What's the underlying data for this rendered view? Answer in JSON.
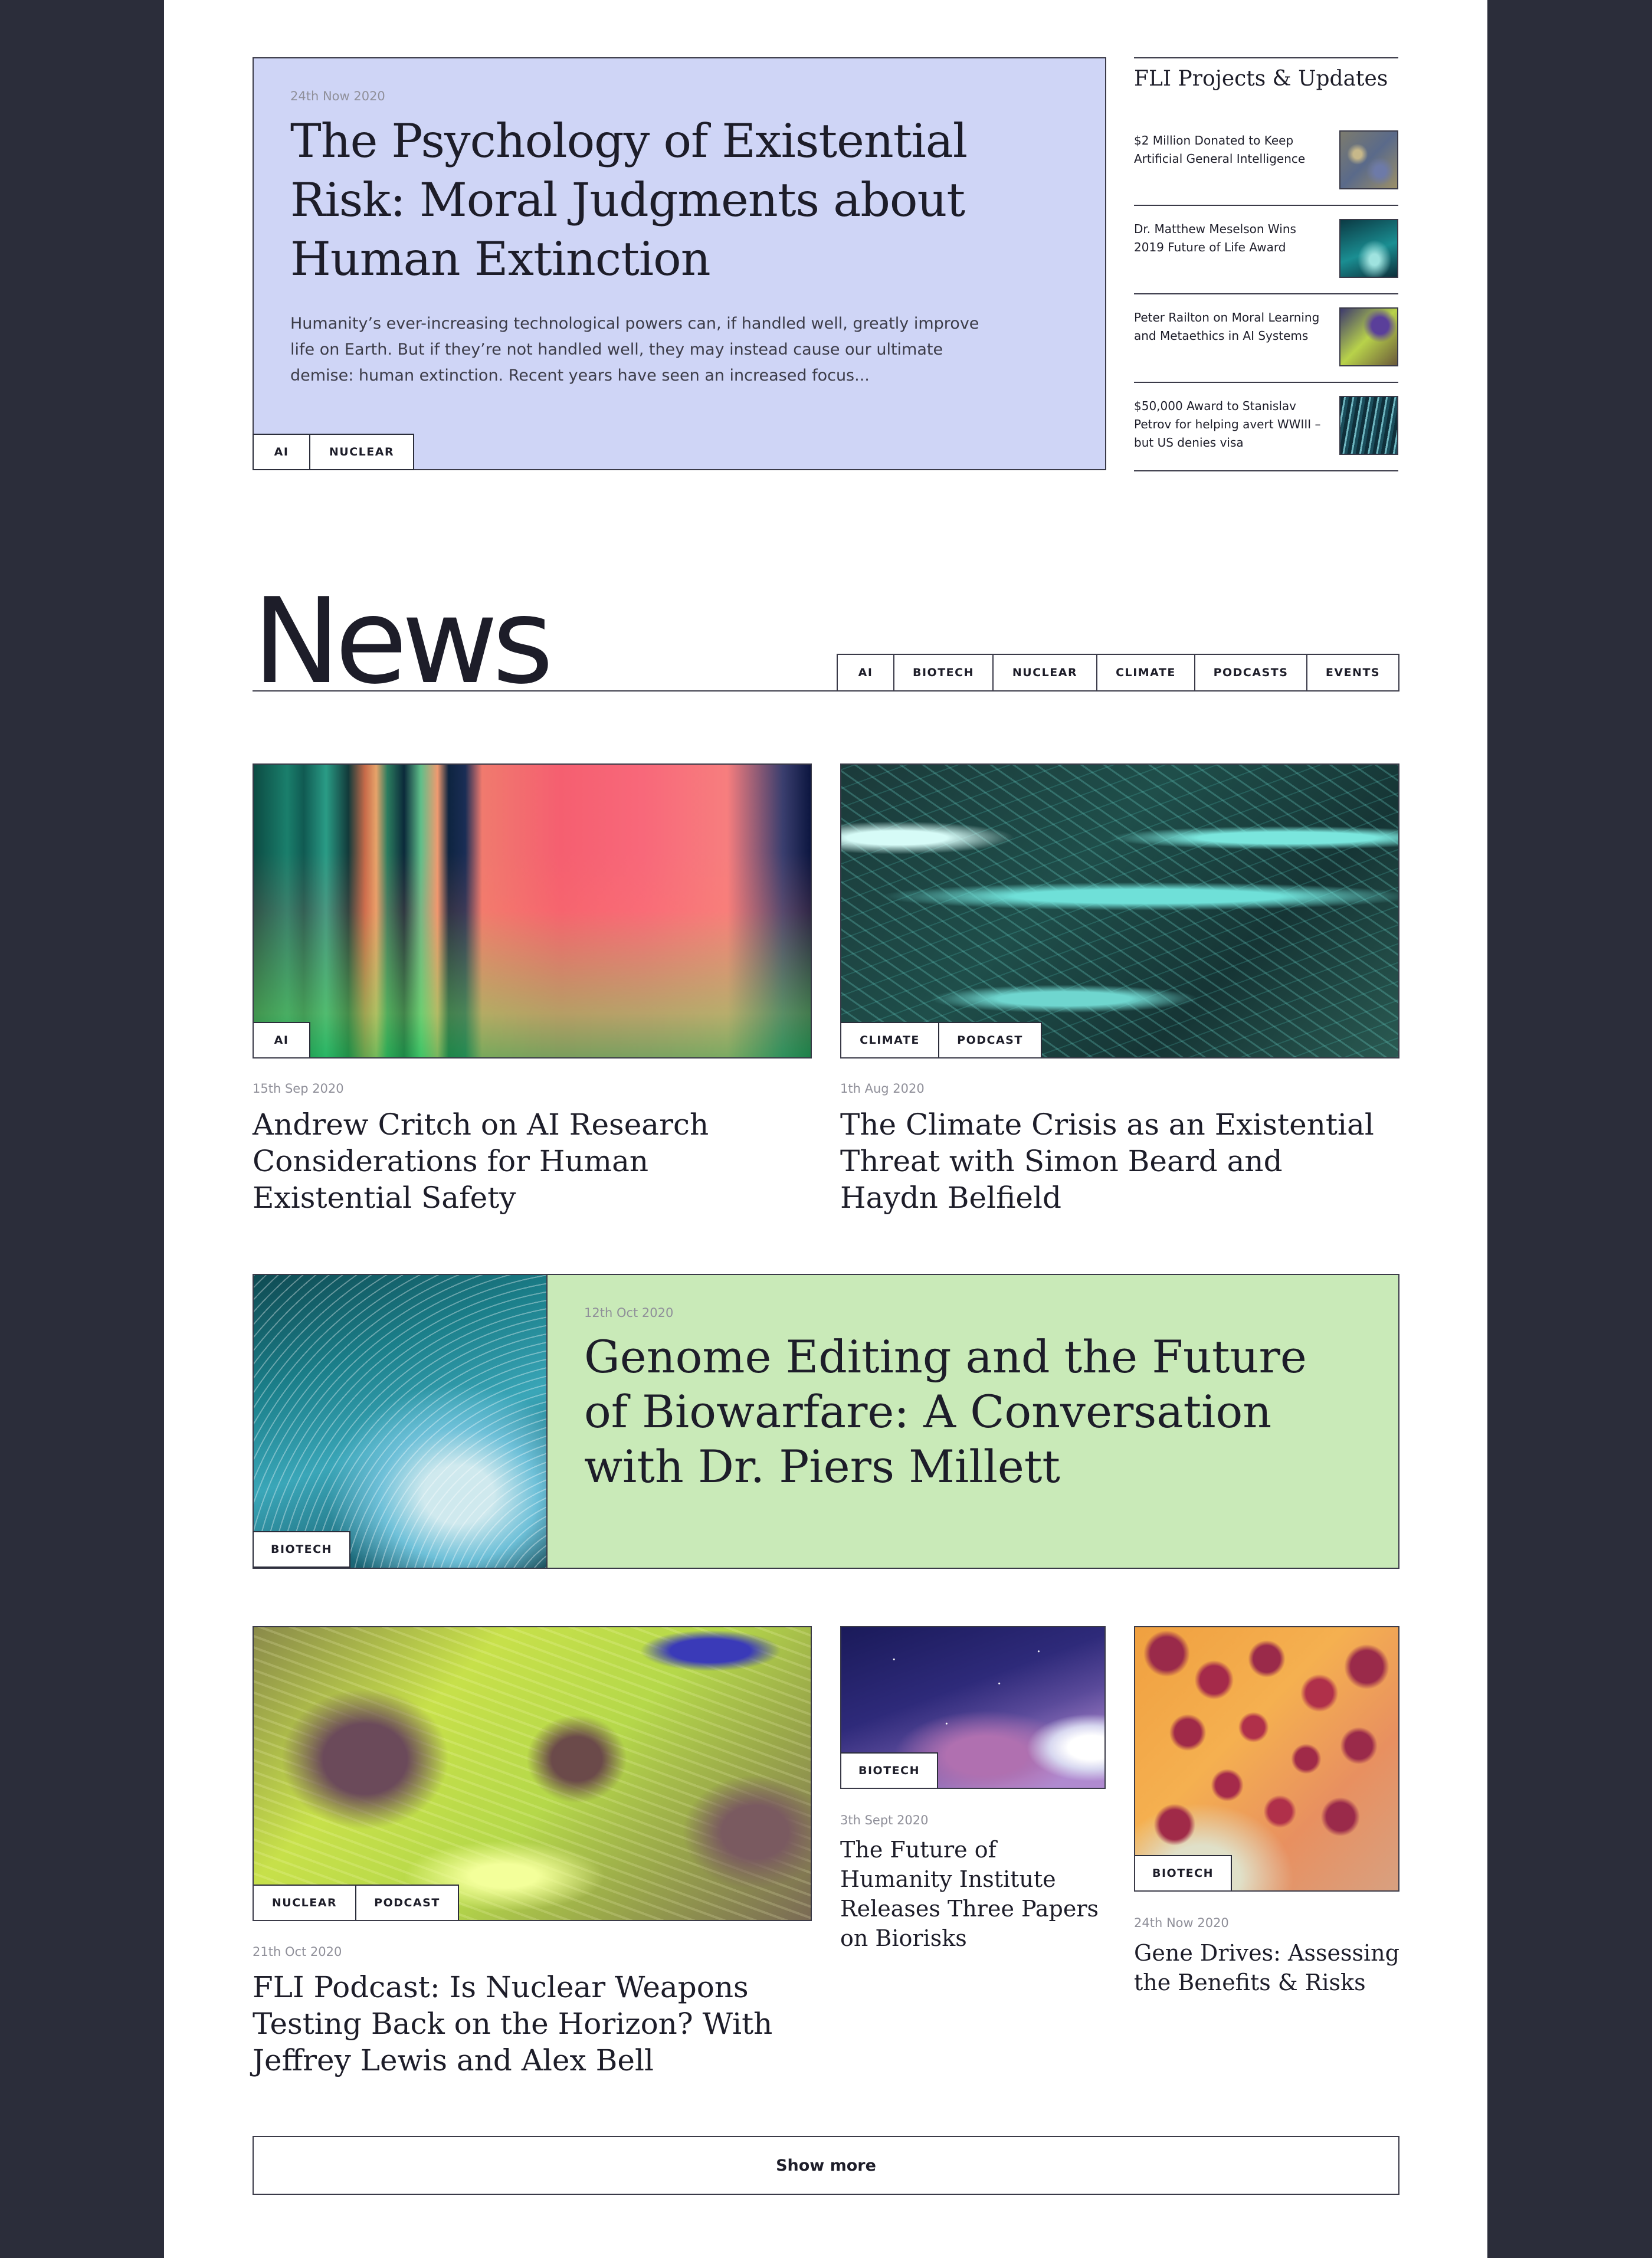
{
  "hero": {
    "date": "24th Now 2020",
    "title": "The Psychology of Existential Risk: Moral Judgments about Human Extinction",
    "excerpt": "Humanity’s ever-increasing technological powers can, if handled well, greatly improve life on Earth. But if they’re not handled well, they may instead cause our ultimate demise: human extinction. Recent years have seen an increased focus...",
    "tags": [
      "AI",
      "NUCLEAR"
    ],
    "bg_color": "#cfd5f6"
  },
  "sidebar": {
    "heading": "FLI Projects & Updates",
    "items": [
      {
        "text": "$2 Million Donated to Keep Artificial General Intelligence"
      },
      {
        "text": "Dr. Matthew Meselson Wins 2019 Future of Life Award"
      },
      {
        "text": "Peter Railton on Moral Learning and Metaethics in AI Systems"
      },
      {
        "text": "$50,000 Award to Stanislav Petrov for helping avert WWIII – but US denies visa"
      }
    ]
  },
  "news": {
    "heading": "News",
    "filters": [
      "AI",
      "BIOTECH",
      "NUCLEAR",
      "CLIMATE",
      "PODCASTS",
      "EVENTS"
    ]
  },
  "cards": [
    {
      "date": "15th Sep 2020",
      "title": "Andrew Critch on AI Research Considerations for Human Existential Safety",
      "tags": [
        "AI"
      ]
    },
    {
      "date": "1th Aug 2020",
      "title": "The Climate Crisis as an Existential Threat with Simon Beard and Haydn Belfield",
      "tags": [
        "CLIMATE",
        "PODCAST"
      ]
    },
    {
      "date": "12th Oct 2020",
      "title": "Genome Editing and the Future of Biowarfare: A Conversation with Dr. Piers Millett",
      "tags": [
        "BIOTECH"
      ],
      "bg_color": "#c9eab8"
    },
    {
      "date": "21th Oct 2020",
      "title": "FLI Podcast: Is Nuclear Weapons Testing Back on the Horizon? With Jeffrey Lewis and Alex Bell",
      "tags": [
        "NUCLEAR",
        "PODCAST"
      ]
    },
    {
      "date": "3th Sept 2020",
      "title": "The Future of Humanity Institute Releases Three Papers on Biorisks",
      "tags": [
        "BIOTECH"
      ]
    },
    {
      "date": "24th Now 2020",
      "title": "Gene Drives: Assessing the Benefits & Risks",
      "tags": [
        "BIOTECH"
      ]
    }
  ],
  "show_more_label": "Show more",
  "colors": {
    "frame": "#2b2d3a",
    "text": "#1d1d29",
    "border": "#3a3a48"
  }
}
